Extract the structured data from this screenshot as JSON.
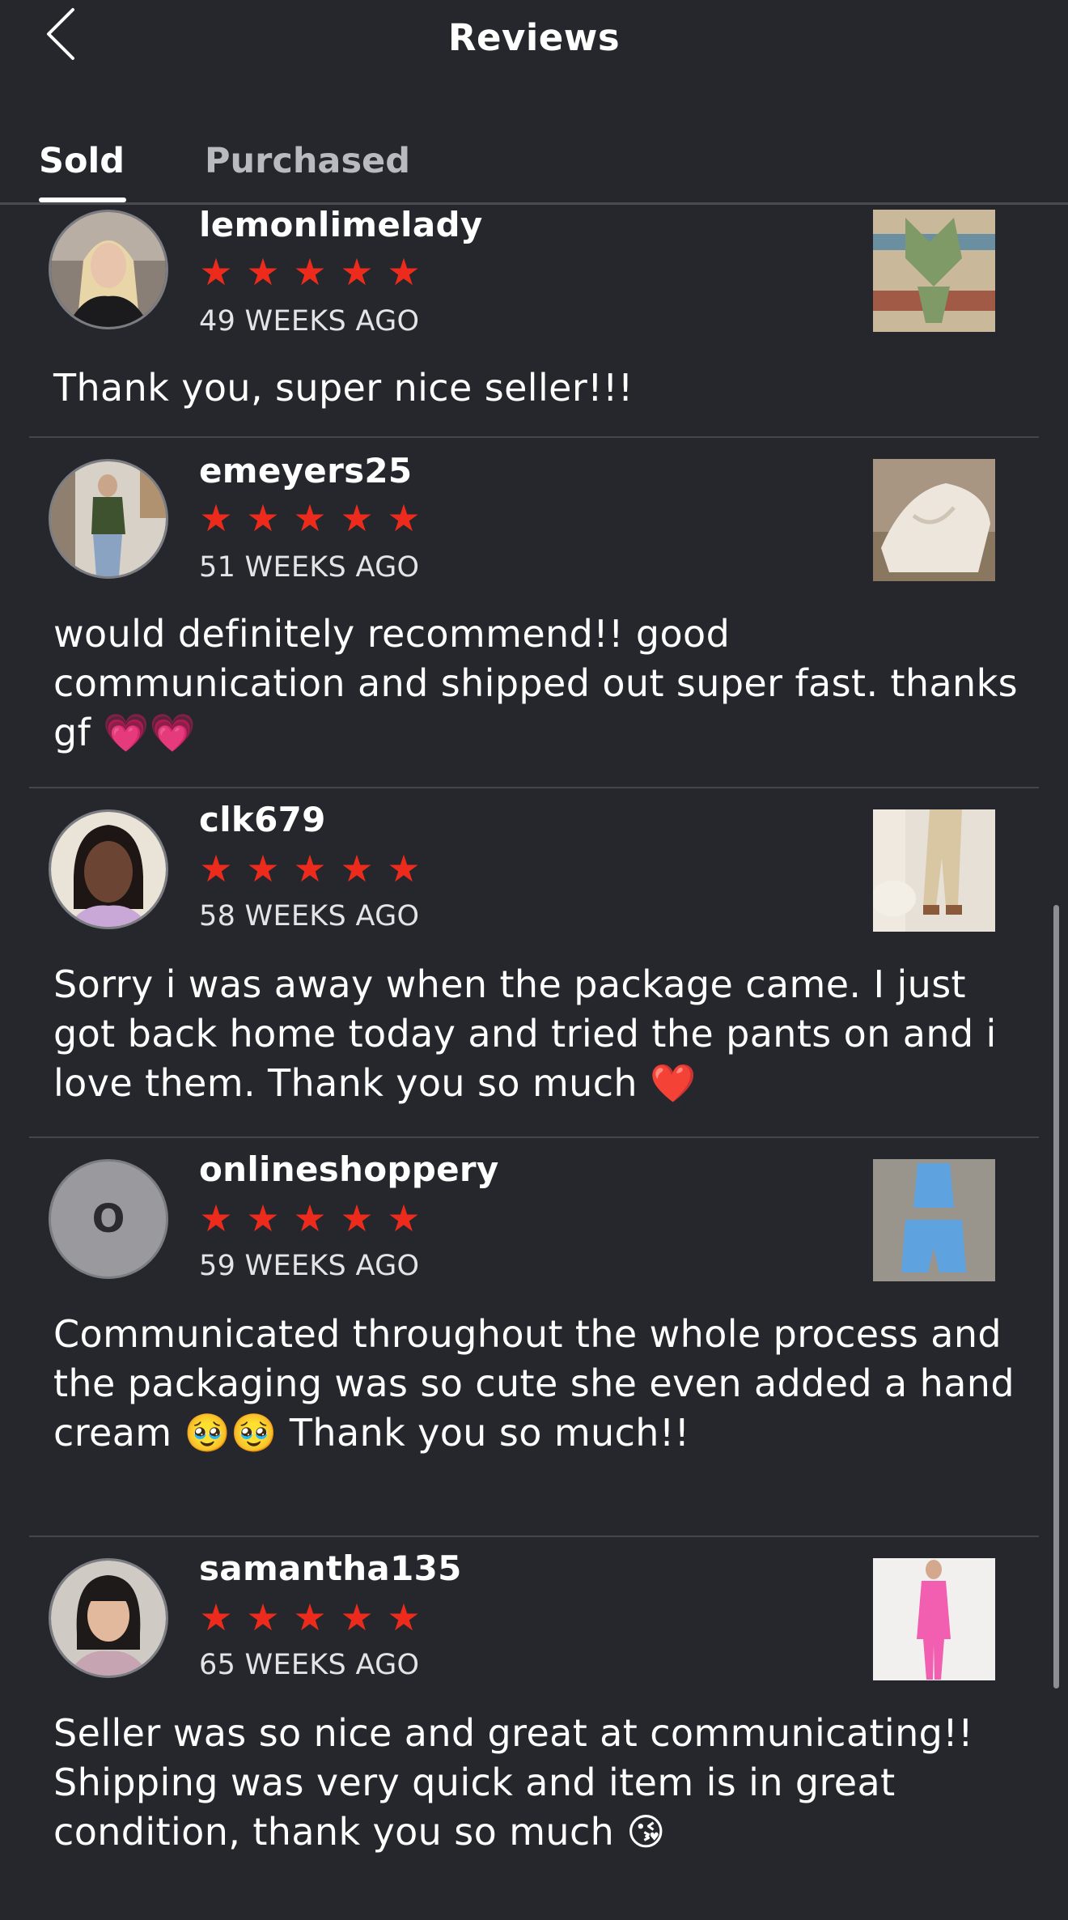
{
  "header": {
    "title": "Reviews",
    "back_icon": "chevron-left-icon"
  },
  "tabs": [
    {
      "label": "Sold",
      "active": true
    },
    {
      "label": "Purchased",
      "active": false
    }
  ],
  "colors": {
    "background": "#26272c",
    "star": "#ec2b1d",
    "divider": "#45464c"
  },
  "reviews": [
    {
      "username": "lemonlimelady",
      "rating": 5,
      "time": "49 WEEKS AGO",
      "text": "Thank you, super nice seller!!!",
      "avatar": "photo"
    },
    {
      "username": "emeyers25",
      "rating": 5,
      "time": "51 WEEKS AGO",
      "text": "would definitely recommend!! good communication and shipped out super fast. thanks gf 💗💗",
      "avatar": "photo"
    },
    {
      "username": "clk679",
      "rating": 5,
      "time": "58 WEEKS AGO",
      "text": "Sorry i was away when the package came. I just got back home today and tried the pants on and i love them. Thank you so much ❤️",
      "avatar": "photo"
    },
    {
      "username": "onlineshoppery",
      "rating": 5,
      "time": "59 WEEKS AGO",
      "text": "Communicated throughout the whole process and the packaging was so cute she even added a hand cream 🥹🥹 Thank you so much!!",
      "avatar": "letter",
      "avatar_letter": "O"
    },
    {
      "username": "samantha135",
      "rating": 5,
      "time": "65 WEEKS AGO",
      "text": "Seller was so nice and great at communicating!! Shipping was very quick and item is in great condition, thank you so much 😘",
      "avatar": "photo"
    }
  ]
}
